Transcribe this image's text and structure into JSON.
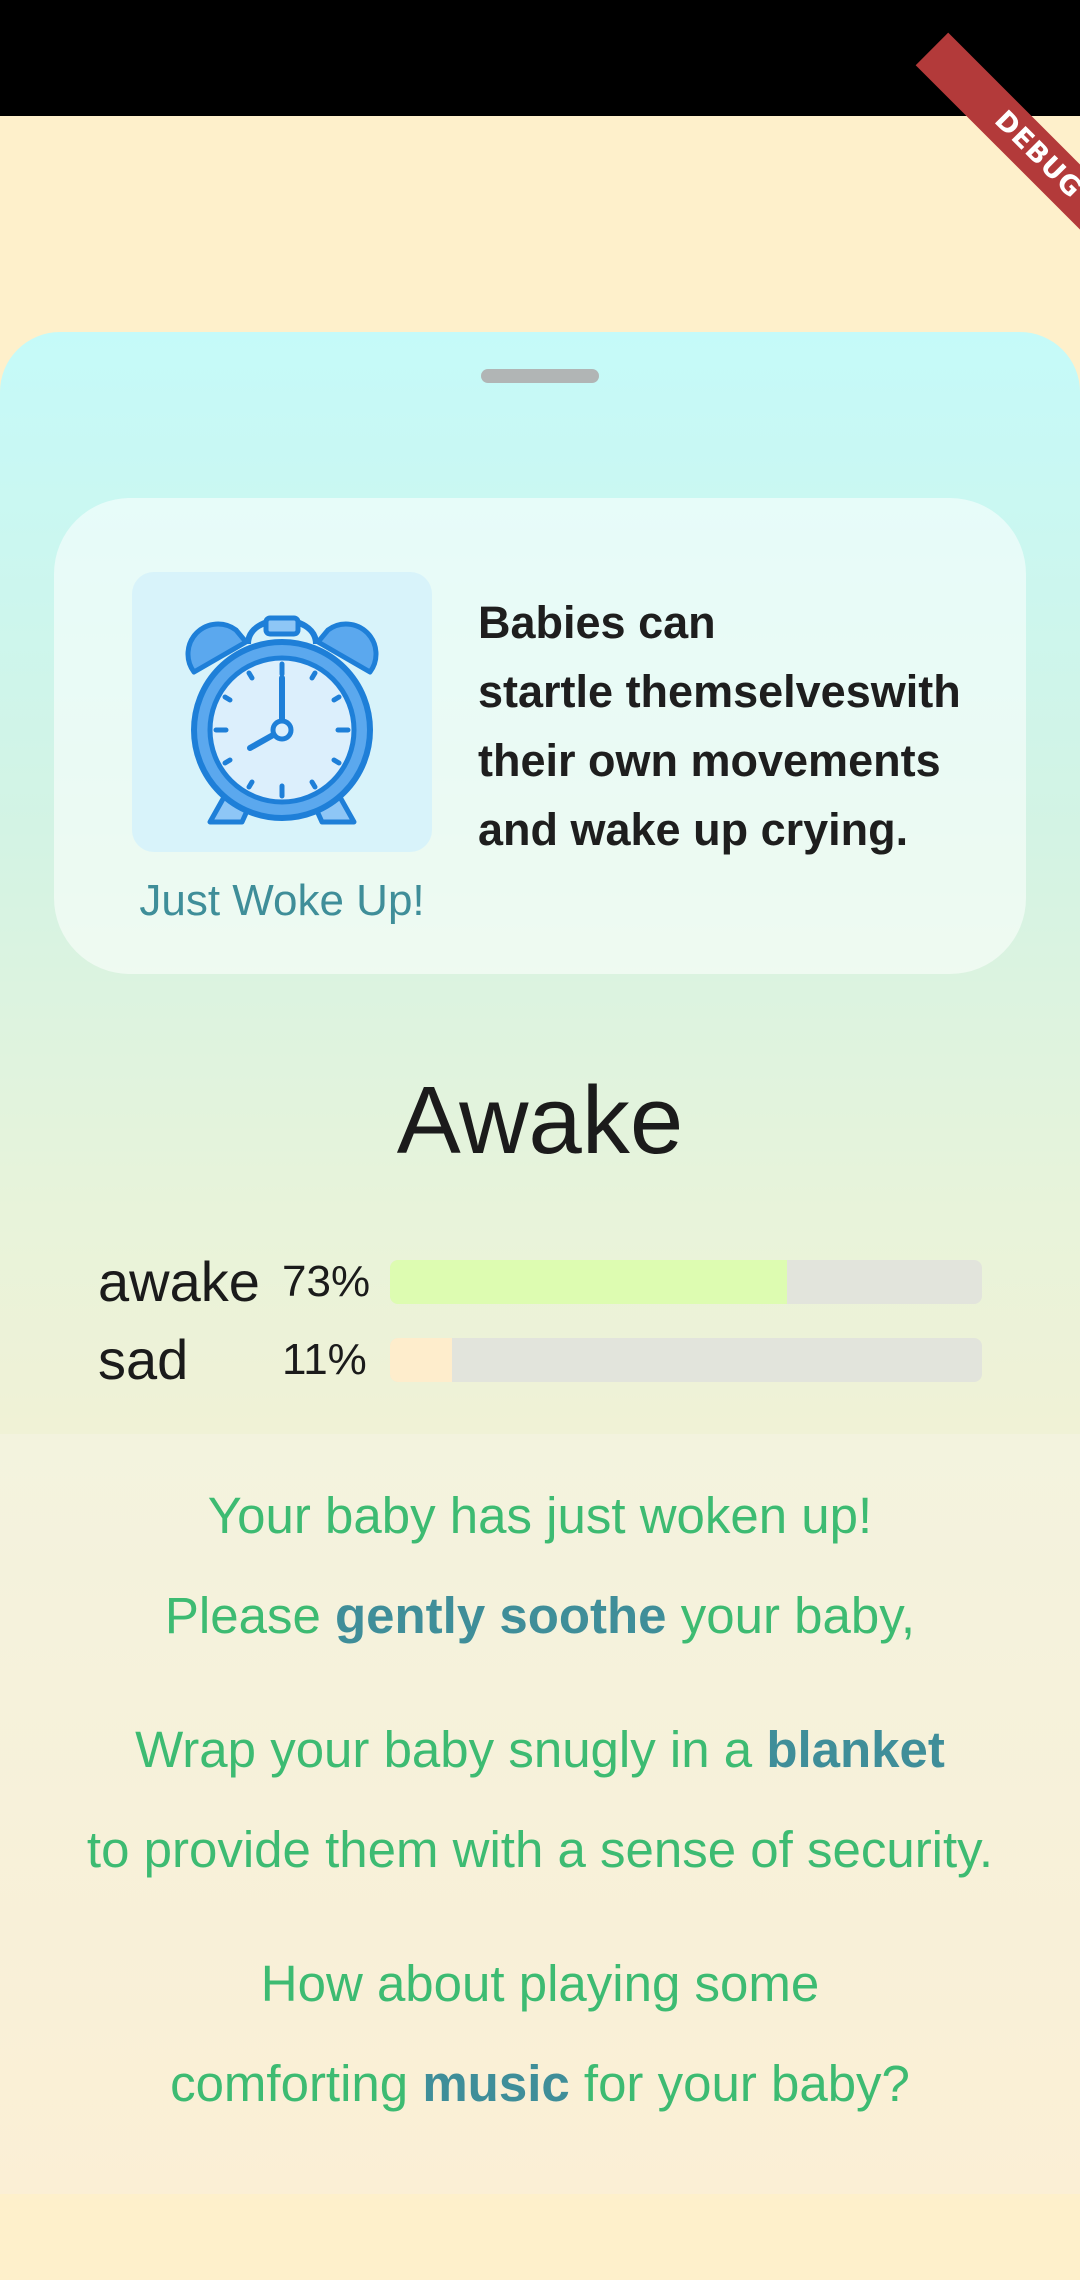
{
  "debug_banner": "DEBUG",
  "info_card": {
    "icon": "alarm-clock-icon",
    "caption": "Just Woke Up!",
    "tip_lines": [
      "Babies can",
      "startle themselveswith",
      "their own movements",
      "and wake up crying."
    ]
  },
  "state_title": "Awake",
  "emotions": [
    {
      "label": "awake",
      "percent_text": "73%",
      "fraction": 0.67,
      "color": "#DDFCB1"
    },
    {
      "label": "sad",
      "percent_text": "11%",
      "fraction": 0.105,
      "color": "#FEEDCC"
    }
  ],
  "advice": [
    {
      "line1": "Your baby has just woken up!",
      "line2_pre": "Please ",
      "line2_bold": "gently soothe",
      "line2_post": " your baby,"
    },
    {
      "line1_pre": "Wrap your baby snugly in a ",
      "line1_bold": "blanket",
      "line2": "to provide them with a sense of security."
    },
    {
      "line1": "How about playing some",
      "line2_pre": "comforting ",
      "line2_bold": "music",
      "line2_post": " for your baby?"
    }
  ],
  "colors": {
    "background": "#FEF0CB",
    "advice_text": "#3DBB72",
    "highlight_text": "#3F8E99",
    "caption_text": "#3F8E99"
  }
}
